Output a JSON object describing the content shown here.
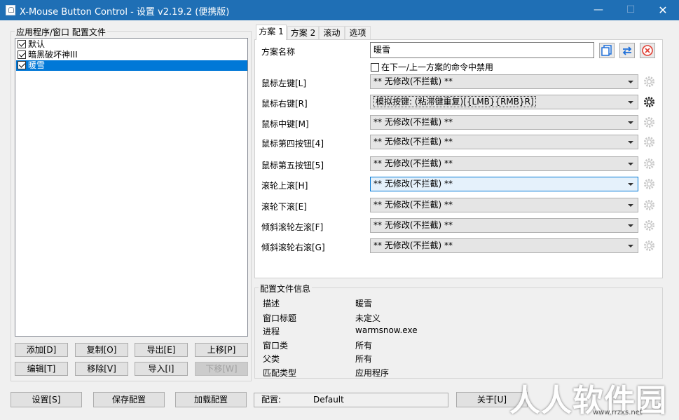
{
  "window": {
    "title": "X-Mouse Button Control - 设置 v2.19.2 (便携版)",
    "min_glyph": "—",
    "max_glyph": "☐",
    "close_glyph": "✕"
  },
  "profiles": {
    "group_label": "应用程序/窗口 配置文件",
    "items": [
      {
        "label": "默认",
        "checked": true
      },
      {
        "label": "暗黑破坏神III",
        "checked": true
      },
      {
        "label": "暖雪",
        "checked": true,
        "selected": true
      }
    ],
    "buttons": {
      "add": "添加[D]",
      "copy": "复制[O]",
      "export": "导出[E]",
      "move_up": "上移[P]",
      "edit": "编辑[T]",
      "remove": "移除[V]",
      "import": "导入[I]",
      "move_down": "下移[W]"
    }
  },
  "tabs": [
    {
      "label": "方案 1",
      "active": true
    },
    {
      "label": "方案 2"
    },
    {
      "label": "滚动"
    },
    {
      "label": "选项"
    }
  ],
  "scheme": {
    "name_label": "方案名称",
    "name_value": "暖雪",
    "disable_checkbox_label": "在下一/上一方案的命令中禁用",
    "rows": [
      {
        "label": "鼠标左键[L]",
        "value": "** 无修改(不拦截) **"
      },
      {
        "label": "鼠标右键[R]",
        "value": "模拟按键: (粘滞键重复)[{LMB}{RMB}R]"
      },
      {
        "label": "鼠标中键[M]",
        "value": "** 无修改(不拦截) **"
      },
      {
        "label": "鼠标第四按钮[4]",
        "value": "** 无修改(不拦截) **"
      },
      {
        "label": "鼠标第五按钮[5]",
        "value": "** 无修改(不拦截) **"
      },
      {
        "label": "滚轮上滚[H]",
        "value": "** 无修改(不拦截) **"
      },
      {
        "label": "滚轮下滚[E]",
        "value": "** 无修改(不拦截) **"
      },
      {
        "label": "倾斜滚轮左滚[F]",
        "value": "** 无修改(不拦截) **"
      },
      {
        "label": "倾斜滚轮右滚[G]",
        "value": "** 无修改(不拦截) **"
      }
    ]
  },
  "profile_info": {
    "group_label": "配置文件信息",
    "rows": [
      {
        "label": "描述",
        "value": "暖雪"
      },
      {
        "label": "窗口标题",
        "value": "未定义"
      },
      {
        "label": "进程",
        "value": "warmsnow.exe"
      },
      {
        "label": "窗口类",
        "value": "所有"
      },
      {
        "label": "父类",
        "value": "所有"
      },
      {
        "label": "匹配类型",
        "value": "应用程序"
      }
    ]
  },
  "bottom": {
    "settings": "设置[S]",
    "save": "保存配置",
    "load": "加载配置",
    "status_label": "配置:",
    "status_value": "Default",
    "about": "关于[U]"
  },
  "watermark": {
    "text": "人人软件园",
    "sub": "www.rrzxs.net"
  },
  "colors": {
    "titlebar": "#1f6fb5",
    "selection": "#0078d7",
    "delete_icon": "#e03c31",
    "swap_icon": "#1e6fd9"
  }
}
